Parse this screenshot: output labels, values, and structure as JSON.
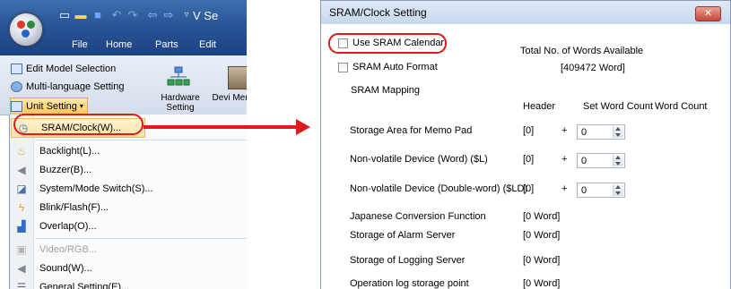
{
  "app": {
    "title": "V Se",
    "tabs": [
      "File",
      "Home",
      "Parts",
      "Edit"
    ],
    "quick_access_icons": [
      "new-icon",
      "open-folder-icon",
      "save-icon",
      "undo-icon",
      "redo-icon",
      "back-arrow-icon",
      "forward-arrow-icon",
      "customize-icon"
    ]
  },
  "ribbon": {
    "edit_model_selection": "Edit Model Selection",
    "multi_language_setting": "Multi-language Setting",
    "unit_setting": "Unit Setting",
    "hardware_setting": "Hardware Setting",
    "device_memory": "Devi Memory"
  },
  "menu": {
    "items": [
      {
        "label": "SRAM/Clock(W)...",
        "icon": "clock-icon",
        "enabled": true,
        "highlighted": true
      },
      {
        "label": "Backlight(L)...",
        "icon": "lightbulb-icon",
        "enabled": true
      },
      {
        "label": "Buzzer(B)...",
        "icon": "speaker-icon",
        "enabled": true
      },
      {
        "label": "System/Mode Switch(S)...",
        "icon": "mode-switch-icon",
        "enabled": true
      },
      {
        "label": "Blink/Flash(F)...",
        "icon": "flash-icon",
        "enabled": true
      },
      {
        "label": "Overlap(O)...",
        "icon": "overlap-icon",
        "enabled": true
      },
      {
        "label": "Video/RGB...",
        "icon": "video-icon",
        "enabled": false
      },
      {
        "label": "Sound(W)...",
        "icon": "sound-icon",
        "enabled": true
      },
      {
        "label": "General Setting(E)...",
        "icon": "general-setting-icon",
        "enabled": true
      }
    ]
  },
  "dialog": {
    "title": "SRAM/Clock Setting",
    "close_label": "✕",
    "use_sram_calendar": "Use SRAM Calendar",
    "sram_auto_format": "SRAM Auto Format",
    "total_words_label": "Total No. of Words Available",
    "total_words_value": "[409472 Word]",
    "mapping_legend": "SRAM Mapping",
    "columns": {
      "header": "Header",
      "set_word_count": "Set Word Count",
      "word_count": "Word Count"
    },
    "rows": [
      {
        "label": "Storage Area for Memo Pad",
        "header": "[0]",
        "plus": "+",
        "value": "0"
      },
      {
        "label": "Non-volatile Device (Word) ($L)",
        "header": "[0]",
        "plus": "+",
        "value": "0"
      },
      {
        "label": "Non-volatile Device (Double-word) ($LD)",
        "header": "[0]",
        "plus": "+",
        "value": "0"
      }
    ],
    "info_rows": [
      {
        "label": "Japanese Conversion Function",
        "header": "[0 Word]"
      },
      {
        "label": "Storage of Alarm Server",
        "header": "[0 Word]"
      },
      {
        "label": "Storage of Logging Server",
        "header": "[0 Word]"
      },
      {
        "label": "Operation log storage point",
        "header": "[0 Word]"
      }
    ]
  },
  "colors": {
    "highlight": "#e0191c",
    "ribbon_blue": "#2a5596"
  }
}
